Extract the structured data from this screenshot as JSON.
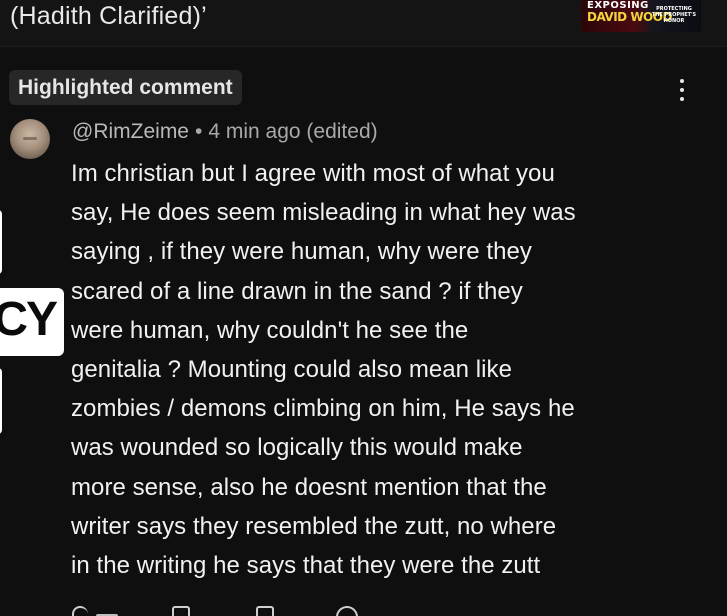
{
  "video": {
    "title_fragment": "(Hadith Clarified)’",
    "thumbnail": {
      "line1": "EXPOSING",
      "line2": "DAVID WOOD",
      "line3": "PROTECTING THE PROPHET'S HONOR"
    }
  },
  "highlight_chip": {
    "label": "Highlighted comment"
  },
  "comment": {
    "author": "@RimZeime",
    "separator": "•",
    "time": "4 min ago (edited)",
    "text": "Im christian but I agree with most of what you\nsay, He does seem misleading in what hey was\nsaying , if they were human, why were they\nscared of a line drawn in the sand ? if they\nwere human, why couldn't he see the\ngenitalia ? Mounting could also mean like\nzombies / demons climbing on him, He says he\nwas wounded so logically this would make\nmore sense, also he doesnt mention that the\nwriter says they resembled the zutt, no where\nin the writing he says that they were the zutt"
  },
  "background_video": {
    "side_label": "ICY"
  },
  "icons": {
    "more": "more-vert-icon",
    "like": "thumbs-up-icon",
    "dislike": "thumbs-down-icon",
    "reply": "reply-icon",
    "heart": "heart-icon"
  },
  "colors": {
    "background": "#0f0f0f",
    "chip_bg": "#272727",
    "text_primary": "#f1f1f1",
    "text_secondary": "#a9a9a9"
  }
}
